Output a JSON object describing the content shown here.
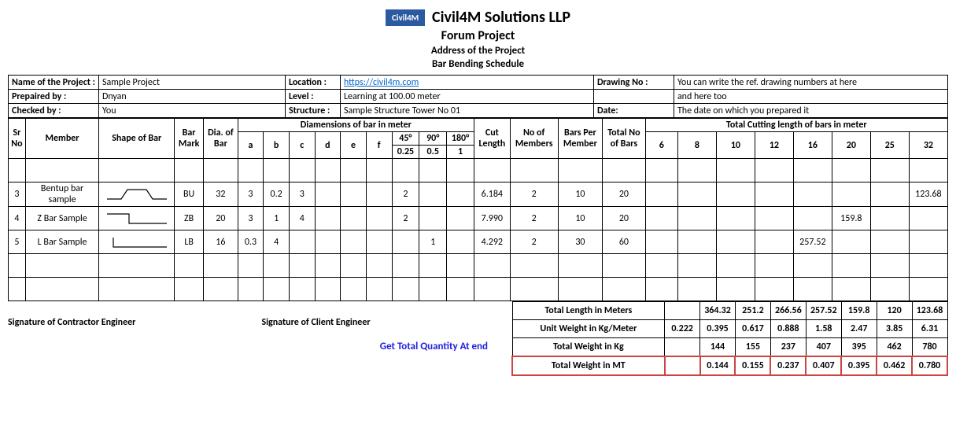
{
  "header": {
    "logo_text": "Civil4M",
    "company": "Civil4M Solutions LLP",
    "project_title": "Forum Project",
    "address": "Address of the Project",
    "doc_title": "Bar Bending Schedule"
  },
  "info": {
    "name_lbl": "Name of the Project :",
    "name_val": "Sample Project",
    "location_lbl": "Location :",
    "location_val": "https://civil4m.com",
    "drawing_lbl": "Drawing No :",
    "drawing_val": "You can write the ref. drawing numbers at here",
    "prep_lbl": "Prepaired by :",
    "prep_val": "Dnyan",
    "level_lbl": "Level :",
    "level_val": "Learning at 100.00 meter",
    "drawing_val2": "and here too",
    "check_lbl": "Checked by :",
    "check_val": "You",
    "struct_lbl": "Structure :",
    "struct_val": "Sample Structure Tower No 01",
    "date_lbl": "Date:",
    "date_val": "The date on which you prepared it"
  },
  "cols": {
    "sr": "Sr No",
    "member": "Member",
    "shape": "Shape of Bar",
    "bar_mark": "Bar Mark",
    "dia": "Dia. of Bar",
    "dim_group": "Diamensions of bar in meter",
    "a": "a",
    "b": "b",
    "c": "c",
    "d": "d",
    "e": "e",
    "f": "f",
    "d45": "45°",
    "d90": "90°",
    "d180": "180°",
    "cut": "Cut Length",
    "d45v": "0.25",
    "d90v": "0.5",
    "d180v": "1",
    "no_members": "No of Members",
    "bars_per": "Bars Per Member",
    "total_bars": "Total No of Bars",
    "tcl": "Total Cutting length of bars in meter",
    "s6": "6",
    "s8": "8",
    "s10": "10",
    "s12": "12",
    "s16": "16",
    "s20": "20",
    "s25": "25",
    "s32": "32"
  },
  "rows": [
    {
      "sr": "3",
      "member": "Bentup bar sample",
      "shape": "bentup",
      "bar_mark": "BU",
      "dia": "32",
      "a": "3",
      "b": "0.2",
      "c": "3",
      "d": "",
      "e": "",
      "f": "",
      "d45": "2",
      "d90": "",
      "d180": "",
      "cut": "6.184",
      "no_members": "2",
      "bars_per": "10",
      "total_bars": "20",
      "s6": "",
      "s8": "",
      "s10": "",
      "s12": "",
      "s16": "",
      "s20": "",
      "s25": "",
      "s32": "123.68"
    },
    {
      "sr": "4",
      "member": "Z Bar Sample",
      "shape": "zbar",
      "bar_mark": "ZB",
      "dia": "20",
      "a": "3",
      "b": "1",
      "c": "4",
      "d": "",
      "e": "",
      "f": "",
      "d45": "2",
      "d90": "",
      "d180": "",
      "cut": "7.990",
      "no_members": "2",
      "bars_per": "10",
      "total_bars": "20",
      "s6": "",
      "s8": "",
      "s10": "",
      "s12": "",
      "s16": "",
      "s20": "159.8",
      "s25": "",
      "s32": ""
    },
    {
      "sr": "5",
      "member": "L Bar Sample",
      "shape": "lbar",
      "bar_mark": "LB",
      "dia": "16",
      "a": "0.3",
      "b": "4",
      "c": "",
      "d": "",
      "e": "",
      "f": "",
      "d45": "",
      "d90": "1",
      "d180": "",
      "cut": "4.292",
      "no_members": "2",
      "bars_per": "30",
      "total_bars": "60",
      "s6": "",
      "s8": "",
      "s10": "",
      "s12": "",
      "s16": "257.52",
      "s20": "",
      "s25": "",
      "s32": ""
    }
  ],
  "totals": {
    "len_lbl": "Total Length in Meters",
    "len": [
      "",
      "364.32",
      "251.2",
      "266.56",
      "257.52",
      "159.8",
      "120",
      "123.68"
    ],
    "uw_lbl": "Unit Weight in Kg/Meter",
    "uw": [
      "0.222",
      "0.395",
      "0.617",
      "0.888",
      "1.58",
      "2.47",
      "3.85",
      "6.31"
    ],
    "kg_lbl": "Total Weight in Kg",
    "kg": [
      "",
      "144",
      "155",
      "237",
      "407",
      "395",
      "462",
      "780"
    ],
    "mt_lbl": "Total Weight in MT",
    "mt": [
      "",
      "0.144",
      "0.155",
      "0.237",
      "0.407",
      "0.395",
      "0.462",
      "0.780"
    ]
  },
  "sig": {
    "contractor": "Signature of Contractor Engineer",
    "client": "Signature of Client Engineer"
  },
  "annotation": "Get Total Quantity At end"
}
